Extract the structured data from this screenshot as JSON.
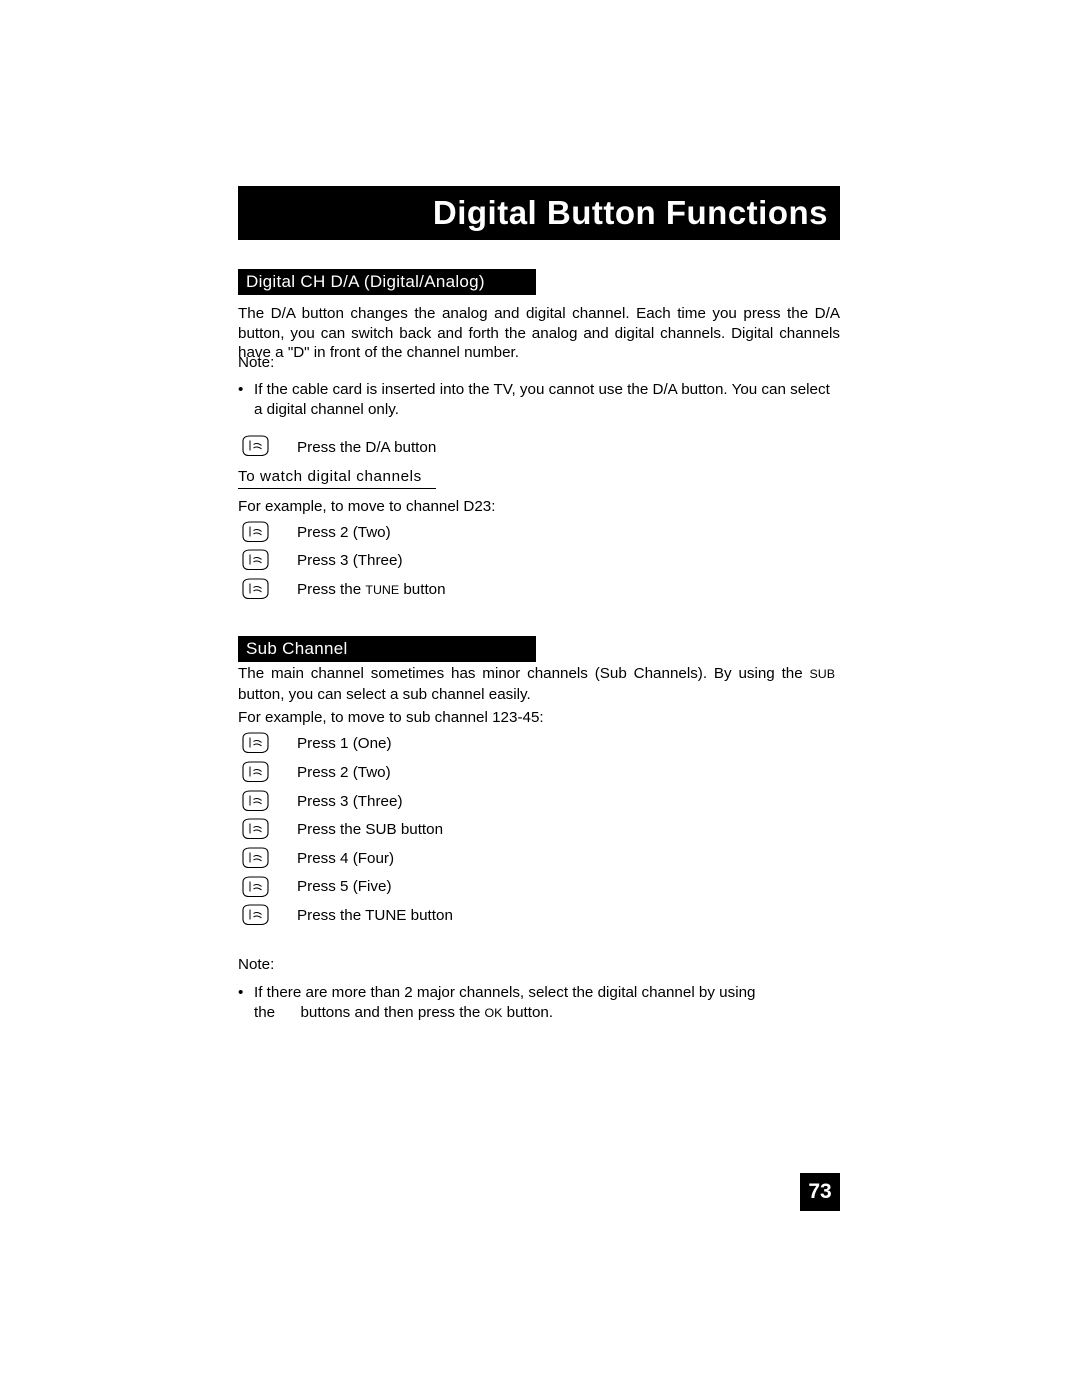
{
  "page": {
    "title": "Digital Button Functions",
    "number": "73"
  },
  "sections": {
    "digital_ch": {
      "heading": "Digital CH D/A (Digital/Analog)",
      "paragraph": "The D/A button changes the analog and digital channel.  Each time you press the D/A button, you can switch back and forth the analog and digital channels.  Digital channels have a \"D\" in front of the channel number.",
      "note_label": "Note:",
      "note_bullet": "If the cable card is inserted into the TV, you cannot use the D/A button.  You can select a digital channel only.",
      "step": "Press the D/A button",
      "subheading": "To watch digital channels",
      "example": "For example, to move to channel D23:",
      "steps": [
        {
          "prefix": "Press 2 (Two)",
          "sc": "",
          "suffix": ""
        },
        {
          "prefix": "Press 3 (Three)",
          "sc": "",
          "suffix": ""
        },
        {
          "prefix": "Press the ",
          "sc": "TUNE",
          "suffix": " button"
        }
      ]
    },
    "sub_channel": {
      "heading": "Sub Channel",
      "paragraph_a": "The main channel sometimes has minor channels (Sub Channels).  By using the ",
      "paragraph_sc": "SUB",
      "paragraph_b": " button, you can select a sub channel easily.",
      "example": "For example, to move to sub channel 123-45:",
      "steps": [
        {
          "prefix": "Press 1 (One)",
          "sc": "",
          "suffix": ""
        },
        {
          "prefix": "Press 2 (Two)",
          "sc": "",
          "suffix": ""
        },
        {
          "prefix": "Press 3 (Three)",
          "sc": "",
          "suffix": ""
        },
        {
          "prefix": "Press the SUB button",
          "sc": "",
          "suffix": ""
        },
        {
          "prefix": "Press 4 (Four)",
          "sc": "",
          "suffix": ""
        },
        {
          "prefix": "Press 5 (Five)",
          "sc": "",
          "suffix": ""
        },
        {
          "prefix": "Press the TUNE button",
          "sc": "",
          "suffix": ""
        }
      ],
      "note_label": "Note:",
      "note_bullet_a": "If there are more than 2 major channels, select the digital channel by using the",
      "note_bullet_b": "buttons and then press the ",
      "note_bullet_sc": "OK",
      "note_bullet_c": " button."
    }
  },
  "icons": {
    "remote_key": "remote-key-icon"
  },
  "colors": {
    "ink": "#000000",
    "paper": "#ffffff"
  }
}
